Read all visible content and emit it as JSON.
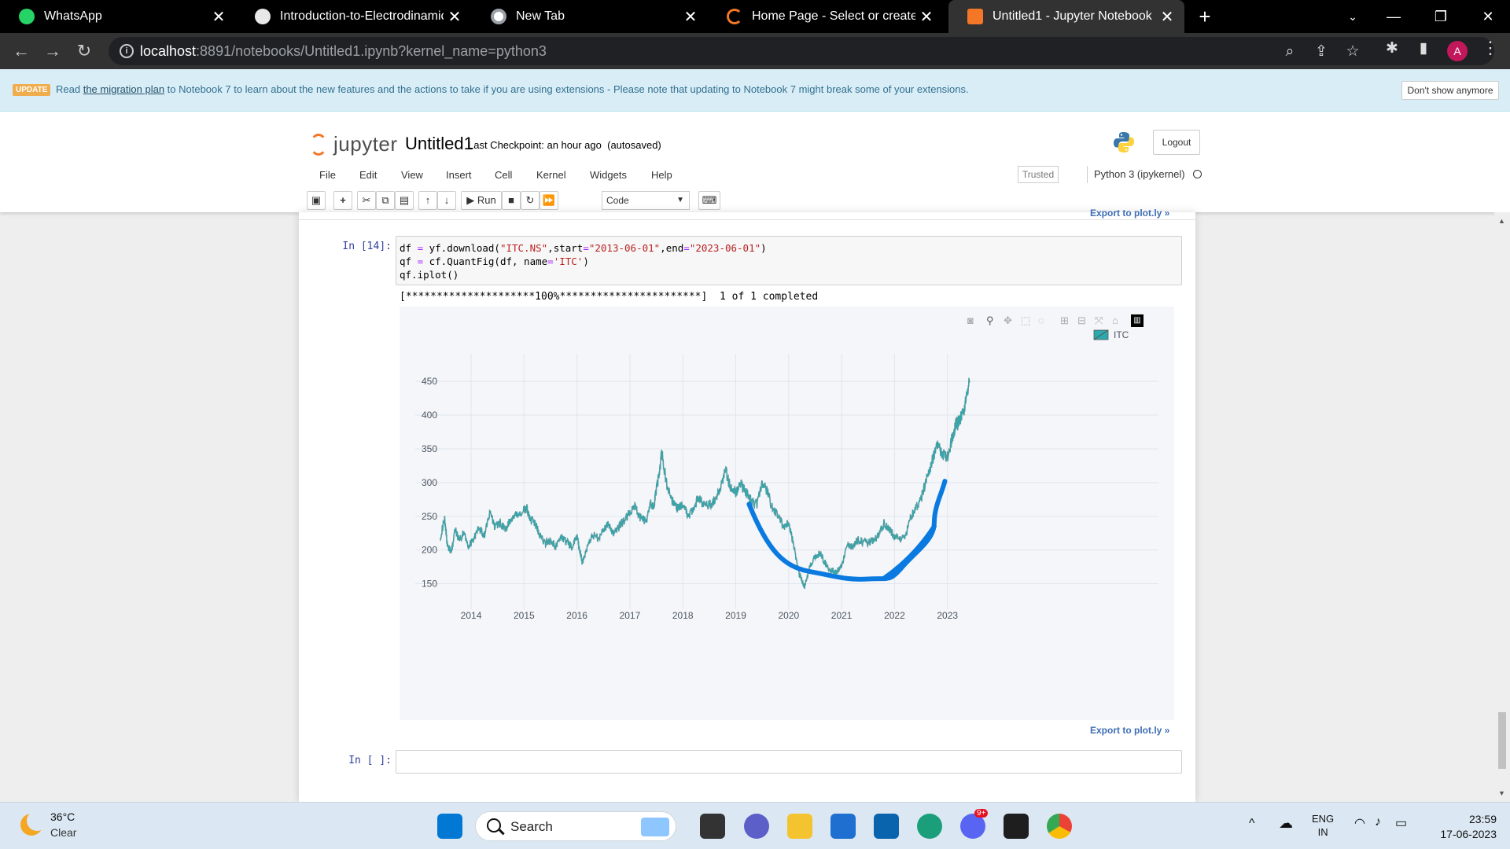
{
  "browser": {
    "tabs": [
      {
        "title": "WhatsApp",
        "icon": "whatsapp-icon"
      },
      {
        "title": "Introduction-to-Electrodinamic.p",
        "icon": "pdf-icon"
      },
      {
        "title": "New Tab",
        "icon": "chrome-icon"
      },
      {
        "title": "Home Page - Select or create a n",
        "icon": "jupyter-loading-icon"
      },
      {
        "title": "Untitled1 - Jupyter Notebook",
        "icon": "notebook-icon",
        "active": true
      }
    ],
    "url_host": "localhost",
    "url_rest": ":8891/notebooks/Untitled1.ipynb?kernel_name=python3",
    "profile_initial": "A"
  },
  "banner": {
    "badge": "UPDATE",
    "text_before": "Read ",
    "link": "the migration plan",
    "text_after": " to Notebook 7 to learn about the new features and the actions to take if you are using extensions - Please note that updating to Notebook 7 might break some of your extensions.",
    "dismiss": "Don't show anymore"
  },
  "header": {
    "logo_text": "jupyter",
    "notebook_name": "Untitled1",
    "checkpoint_label": "Last Checkpoint:",
    "checkpoint_time": "an hour ago",
    "autosave": "(autosaved)",
    "logout": "Logout"
  },
  "menu": {
    "items": [
      "File",
      "Edit",
      "View",
      "Insert",
      "Cell",
      "Kernel",
      "Widgets",
      "Help"
    ],
    "trusted": "Trusted",
    "kernel": "Python 3 (ipykernel)"
  },
  "toolbar": {
    "run_label": "Run",
    "cell_type": "Code"
  },
  "cells": {
    "export_link": "Export to plot.ly »",
    "cell1_prompt": "In [14]:",
    "cell1_code": [
      "df = yf.download(\"ITC.NS\",start=\"2013-06-01\",end=\"2023-06-01\")",
      "qf = cf.QuantFig(df, name='ITC')",
      "qf.iplot()"
    ],
    "cell1_stdout": "[*********************100%***********************]  1 of 1 completed",
    "cell2_prompt": "In [ ]:"
  },
  "chart_data": {
    "type": "line",
    "title": "",
    "legend": [
      "ITC"
    ],
    "legend_position": "top-right",
    "xlabel": "",
    "ylabel": "",
    "x_ticks": [
      "2014",
      "2015",
      "2016",
      "2017",
      "2018",
      "2019",
      "2020",
      "2021",
      "2022",
      "2023"
    ],
    "y_ticks": [
      150,
      200,
      250,
      300,
      350,
      400,
      450
    ],
    "ylim": [
      125,
      470
    ],
    "xlim": [
      2013.42,
      2023.42
    ],
    "grid": true,
    "series": [
      {
        "name": "ITC",
        "color": "#2ca9ad",
        "x": [
          2013.42,
          2013.5,
          2013.55,
          2013.62,
          2013.7,
          2013.78,
          2013.86,
          2013.95,
          2014.05,
          2014.15,
          2014.25,
          2014.35,
          2014.45,
          2014.55,
          2014.65,
          2014.75,
          2014.85,
          2014.95,
          2015.05,
          2015.12,
          2015.2,
          2015.3,
          2015.4,
          2015.5,
          2015.6,
          2015.7,
          2015.8,
          2015.9,
          2016.0,
          2016.05,
          2016.1,
          2016.2,
          2016.3,
          2016.4,
          2016.5,
          2016.6,
          2016.7,
          2016.8,
          2016.9,
          2017.0,
          2017.1,
          2017.2,
          2017.3,
          2017.4,
          2017.45,
          2017.5,
          2017.55,
          2017.6,
          2017.7,
          2017.8,
          2017.9,
          2018.0,
          2018.1,
          2018.2,
          2018.3,
          2018.4,
          2018.5,
          2018.6,
          2018.7,
          2018.8,
          2018.9,
          2019.0,
          2019.1,
          2019.2,
          2019.3,
          2019.4,
          2019.5,
          2019.6,
          2019.7,
          2019.8,
          2019.9,
          2020.0,
          2020.1,
          2020.2,
          2020.3,
          2020.4,
          2020.5,
          2020.6,
          2020.7,
          2020.8,
          2020.9,
          2021.0,
          2021.1,
          2021.2,
          2021.3,
          2021.4,
          2021.5,
          2021.6,
          2021.7,
          2021.8,
          2021.9,
          2022.0,
          2022.1,
          2022.2,
          2022.3,
          2022.4,
          2022.5,
          2022.6,
          2022.7,
          2022.8,
          2022.9,
          2023.0,
          2023.1,
          2023.15,
          2023.2,
          2023.25,
          2023.3,
          2023.35,
          2023.42
        ],
        "y": [
          220,
          245,
          210,
          195,
          230,
          215,
          225,
          205,
          218,
          232,
          222,
          255,
          235,
          240,
          230,
          245,
          250,
          255,
          262,
          245,
          240,
          222,
          210,
          215,
          205,
          220,
          212,
          205,
          220,
          200,
          182,
          205,
          222,
          218,
          230,
          238,
          222,
          235,
          245,
          255,
          265,
          248,
          242,
          270,
          262,
          290,
          310,
          345,
          295,
          272,
          262,
          268,
          250,
          262,
          278,
          265,
          268,
          272,
          288,
          320,
          292,
          285,
          298,
          285,
          272,
          268,
          300,
          285,
          260,
          250,
          235,
          240,
          205,
          165,
          145,
          175,
          190,
          195,
          178,
          170,
          168,
          175,
          210,
          205,
          215,
          212,
          210,
          215,
          220,
          240,
          230,
          220,
          215,
          218,
          248,
          262,
          275,
          305,
          330,
          355,
          345,
          338,
          370,
          385,
          388,
          395,
          405,
          420,
          450
        ]
      }
    ],
    "annotation": {
      "type": "hand-drawn-curve",
      "color": "#0a7ae0"
    }
  },
  "taskbar": {
    "temperature": "36°C",
    "condition": "Clear",
    "search": "Search",
    "lang1": "ENG",
    "lang2": "IN",
    "time": "23:59",
    "date": "17-06-2023",
    "chat_badge": "9+"
  }
}
